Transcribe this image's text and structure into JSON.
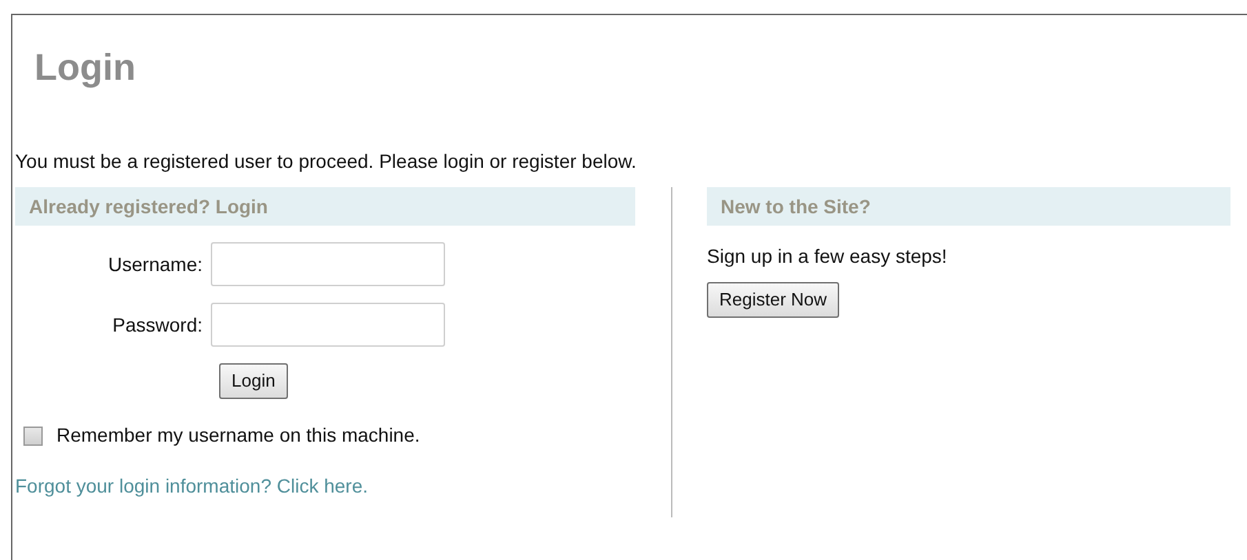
{
  "title": "Login",
  "intro": "You must be a registered user to proceed. Please login or register below.",
  "login_section": {
    "heading": "Already registered? Login",
    "fields": [
      {
        "label": "Username:"
      },
      {
        "label": "Password:"
      }
    ],
    "button": "Login",
    "remember": {
      "label": "Remember my username on this machine.",
      "checked": false
    },
    "forgot_link": "Forgot your login information? Click here."
  },
  "register_section": {
    "heading": "New to the Site?",
    "text": "Sign up in a few easy steps!",
    "button": "Register Now"
  }
}
